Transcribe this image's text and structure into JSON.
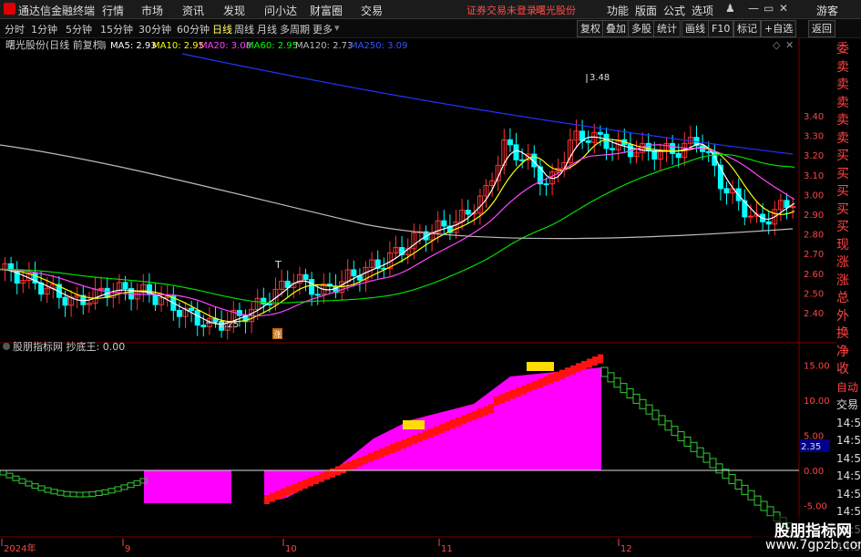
{
  "app": {
    "title": "通达信金融终端"
  },
  "menu": [
    "行情",
    "市场",
    "资讯",
    "发现",
    "问小达",
    "财富圈",
    "交易"
  ],
  "notice": "证券交易未登录",
  "notice_stock": "曙光股份",
  "right_menu": [
    "功能",
    "版面",
    "公式",
    "选项"
  ],
  "window_buttons": [
    "游客"
  ],
  "periods": [
    "分时",
    "1分钟",
    "5分钟",
    "15分钟",
    "30分钟",
    "60分钟",
    "日线",
    "周线",
    "月线",
    "多周期",
    "更多"
  ],
  "active_period": "日线",
  "toolbar_buttons": [
    "复权",
    "叠加",
    "多股",
    "统计",
    "画线",
    "F10",
    "标记",
    "+自选",
    "返回"
  ],
  "ma_header": {
    "stock": "曙光股份(日线 前复权)",
    "items": [
      {
        "label": "MA5: 2.93",
        "color": "#ffffff"
      },
      {
        "label": "MA10: 2.95",
        "color": "#ffff00"
      },
      {
        "label": "MA20: 3.08",
        "color": "#ff44ff"
      },
      {
        "label": "MA60: 2.95",
        "color": "#00ff00"
      },
      {
        "label": "MA120: 2.73",
        "color": "#bbbbbb"
      },
      {
        "label": "MA250: 3.09",
        "color": "#3355ff"
      }
    ]
  },
  "price_axis": [
    "3.40",
    "3.30",
    "3.20",
    "3.10",
    "3.00",
    "2.90",
    "2.80",
    "2.70",
    "2.60",
    "2.50",
    "2.40"
  ],
  "annotations": {
    "high": "3.48",
    "low": "2.25",
    "t_mark": "T",
    "stamp": "涨"
  },
  "indicator_header": "股朋指标网 抄底王: 0.00",
  "indicator_axis": [
    "15.00",
    "10.00",
    "5.00",
    "0.00",
    "-5.00"
  ],
  "indicator_value": "2.35",
  "date_axis": [
    "2024年",
    "9",
    "10",
    "11",
    "12"
  ],
  "side_panel": [
    "委比",
    "卖五",
    "卖四",
    "卖三",
    "卖二",
    "卖一",
    "买一",
    "买二",
    "买三",
    "买四",
    "买五",
    "现价",
    "涨跌",
    "涨幅",
    "总量",
    "外盘",
    "换手",
    "净资",
    "收益",
    "自动",
    "交易",
    "14:56",
    "14:56",
    "14:56",
    "14:56",
    "14:56",
    "14:56",
    "14:56",
    "14:56"
  ],
  "watermark": {
    "cn": "股朋指标网",
    "url": "www.7gpzb.com"
  },
  "colors": {
    "up": "#ff3333",
    "down": "#00ffff",
    "magenta": "#ff00ff",
    "bg": "#000000",
    "grid": "#8b0000"
  }
}
